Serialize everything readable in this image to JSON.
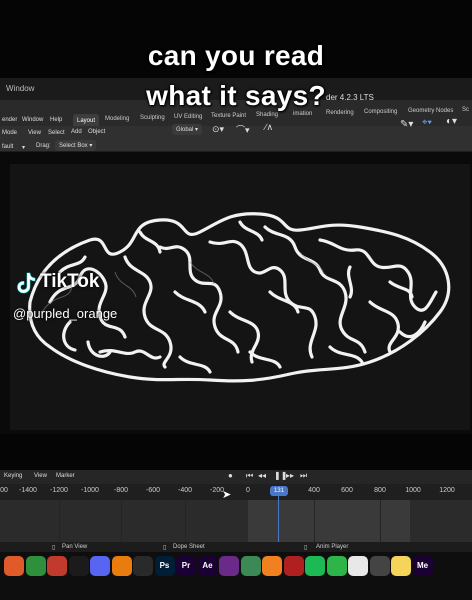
{
  "caption": {
    "line1": "can you read",
    "line2": "what it says?"
  },
  "watermark": {
    "brand": "TikTok",
    "handle": "@purpled_orange"
  },
  "window": {
    "title": "Window",
    "version": "der 4.2.3 LTS"
  },
  "menus": [
    "ender",
    "Window",
    "Help"
  ],
  "workspace_tabs": [
    "Layout",
    "Modeling",
    "Sculpting",
    "UV Editing",
    "Texture Paint",
    "Shading",
    "imation",
    "Rendering",
    "Compositing",
    "Geometry Nodes",
    "Sc"
  ],
  "active_tab": "Layout",
  "toolbar": {
    "mode": "Mode",
    "view": "View",
    "select": "Select",
    "add": "Add",
    "object": "Object",
    "orientation": "Global",
    "preset": "fault",
    "drag_label": "Drag:",
    "drag_value": "Select Box"
  },
  "timeline": {
    "menus": [
      "Keying",
      "View",
      "Marker"
    ],
    "ticks": [
      "00",
      "-1400",
      "-1200",
      "-1000",
      "-800",
      "-600",
      "-400",
      "-200",
      "0",
      "200",
      "400",
      "600",
      "800",
      "1000",
      "1200"
    ],
    "current_frame": "131"
  },
  "statusbar": {
    "pan_view": "Pan View",
    "dope_sheet": "Dope Sheet",
    "anim_player": "Anim Player"
  },
  "dock_apps": [
    {
      "icon": "photos-icon",
      "label": "",
      "color": "#e05a2a"
    },
    {
      "icon": "chrome-icon",
      "label": "",
      "color": "#2f8f3c"
    },
    {
      "icon": "app-icon",
      "label": "",
      "color": "#c23a2e"
    },
    {
      "icon": "music-icon",
      "label": "",
      "color": "#1b1b1b"
    },
    {
      "icon": "discord-icon",
      "label": "",
      "color": "#5865f2"
    },
    {
      "icon": "blender-icon",
      "label": "",
      "color": "#e87d0d"
    },
    {
      "icon": "davinci-icon",
      "label": "",
      "color": "#2a2a2a"
    },
    {
      "icon": "photoshop-icon",
      "label": "Ps",
      "color": "#001e36"
    },
    {
      "icon": "premiere-icon",
      "label": "Pr",
      "color": "#1a0033"
    },
    {
      "icon": "aftereffects-icon",
      "label": "Ae",
      "color": "#1a0033"
    },
    {
      "icon": "affinity-icon",
      "label": "",
      "color": "#6b2a8a"
    },
    {
      "icon": "substance-icon",
      "label": "",
      "color": "#3b8a55"
    },
    {
      "icon": "fl-studio-icon",
      "label": "",
      "color": "#f08020"
    },
    {
      "icon": "app-icon-2",
      "label": "",
      "color": "#b02020"
    },
    {
      "icon": "spotify-icon",
      "label": "",
      "color": "#1db954"
    },
    {
      "icon": "messages-icon",
      "label": "",
      "color": "#2db54a"
    },
    {
      "icon": "calendar-icon",
      "label": "",
      "color": "#e8e8e8"
    },
    {
      "icon": "launchpad-icon",
      "label": "",
      "color": "#444"
    },
    {
      "icon": "notes-icon",
      "label": "",
      "color": "#f5d45a"
    },
    {
      "icon": "media-encoder-icon",
      "label": "Me",
      "color": "#1a0033"
    }
  ]
}
